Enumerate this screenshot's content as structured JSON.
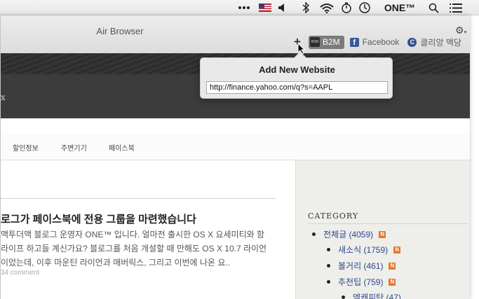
{
  "menubar": {
    "icons": [
      "ellipsis-icon",
      "us-flag-icon",
      "volume-icon",
      "bluetooth-icon",
      "wifi-icon",
      "timer-icon",
      "clock-icon",
      "spotlight-icon",
      "list-icon"
    ],
    "app_label": "ONE™"
  },
  "window": {
    "title": "Air Browser",
    "bookmarks": [
      {
        "label": "B2M",
        "active": true
      },
      {
        "label": "Facebook"
      },
      {
        "label": "클리앙 맥당"
      }
    ]
  },
  "popover": {
    "title": "Add New Website",
    "url_value": "http://finance.yahoo.com/q?s=AAPL"
  },
  "site": {
    "header_fragment": "x",
    "nav": [
      "할인정보",
      "주변기기",
      "페이스북"
    ],
    "post": {
      "title": "로그가 페이스북에 전용 그룹을 마련했습니다",
      "lines": [
        "맥투더맥 블로그 운영자 ONE™ 입니다. 얼마전 출시한 OS X 요세미티와 함",
        "라이프 하고들 계신가요? 블로그를 처음 개설할 때 만해도 OS X 10.7 라이언",
        "이었는데, 이후 마운틴 라이언과 매버릭스, 그리고 이번에 나온 요.."
      ],
      "meta": "34 comment"
    },
    "sidebar": {
      "heading": "CATEGORY",
      "items": [
        {
          "label": "전체글 (4059)",
          "rss": true
        },
        {
          "label": "새소식 (1759)",
          "rss": true
        },
        {
          "label": "볼거리 (461)",
          "rss": true
        },
        {
          "label": "추천팁 (759)",
          "rss": true
        },
        {
          "label": "엠캐피탄 (47)",
          "rss": false
        }
      ]
    }
  },
  "colors": {
    "menubar_bg": "#eeeeee",
    "site_header_bg": "#3c3c3c",
    "link": "#2a4a8a",
    "rss": "#e8742a",
    "facebook": "#3b5998"
  }
}
